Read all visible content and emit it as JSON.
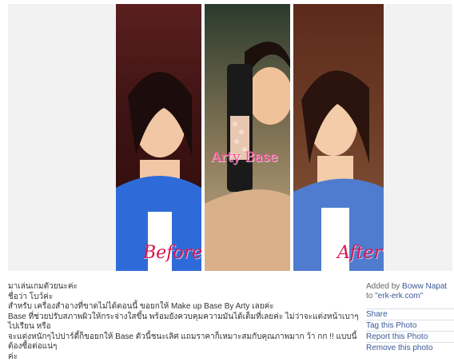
{
  "photo": {
    "labels": {
      "before": "Before",
      "middle": "Arty Base",
      "after": "After"
    }
  },
  "caption": {
    "lines": [
      "มาเล่นเกมตัวยนะค่ะ",
      "ชื่อว่า โบว์ค่ะ",
      "สำหรับ เครื่องสำอางที่ขาดไม่ได้ตอนนี้ ขอยกให้ Make up Base By Arty เลยค่ะ",
      "Base ที่ช่วยปรับสภาพผิวให้กระจ่างใสขึ้น พร้อมยังควบคุมความมันได้เต็มที่เลยค่ะ ไม่ว่าจะแต่งหน้าเบาๆ ไปเรียน หรือ",
      "จะแต่งหนักๆไปปาร์ตี้ก็ขอยกให้ Base ตัวนี้ชนะเลิศ แถมราคาก็เหมาะสมกับคุณภาพมาก ว้า กก !! แบบนี้ต้องซื้อต่อแน่ๆ",
      "ค่ะ"
    ]
  },
  "meta": {
    "added_by_prefix": "Added by",
    "author": "Boww Napat",
    "to_prefix": "to",
    "album": "\"erk-erk.com\""
  },
  "actions": {
    "share": "Share",
    "tag": "Tag this Photo",
    "report": "Report this Photo",
    "remove": "Remove this photo"
  }
}
